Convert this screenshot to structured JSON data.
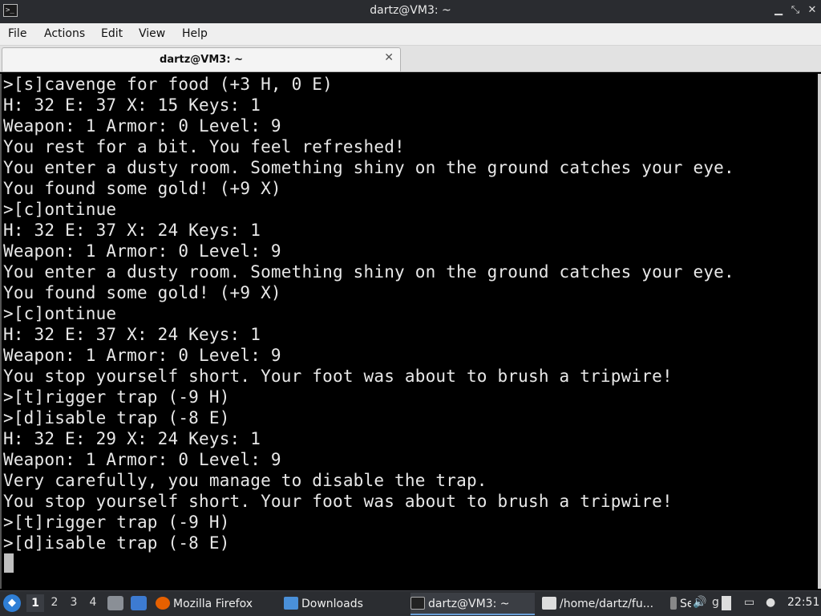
{
  "window": {
    "title": "dartz@VM3: ~",
    "controls": {
      "minimize": "▁",
      "maximize": "⤡",
      "close": "✕"
    }
  },
  "menubar": {
    "items": [
      "File",
      "Actions",
      "Edit",
      "View",
      "Help"
    ]
  },
  "tabs": [
    {
      "label": "dartz@VM3: ~",
      "close": "✕"
    }
  ],
  "terminal": {
    "lines": [
      ">[s]cavenge for food (+3 H, 0 E)",
      "H: 32 E: 37 X: 15 Keys: 1",
      "Weapon: 1 Armor: 0 Level: 9",
      "You rest for a bit. You feel refreshed!",
      "You enter a dusty room. Something shiny on the ground catches your eye.",
      "You found some gold! (+9 X)",
      ">[c]ontinue",
      "H: 32 E: 37 X: 24 Keys: 1",
      "Weapon: 1 Armor: 0 Level: 9",
      "You enter a dusty room. Something shiny on the ground catches your eye.",
      "You found some gold! (+9 X)",
      ">[c]ontinue",
      "H: 32 E: 37 X: 24 Keys: 1",
      "Weapon: 1 Armor: 0 Level: 9",
      "You stop yourself short. Your foot was about to brush a tripwire!",
      ">[t]rigger trap (-9 H)",
      ">[d]isable trap (-8 E)",
      "H: 32 E: 29 X: 24 Keys: 1",
      "Weapon: 1 Armor: 0 Level: 9",
      "Very carefully, you manage to disable the trap.",
      "You stop yourself short. Your foot was about to brush a tripwire!",
      ">[t]rigger trap (-9 H)",
      ">[d]isable trap (-8 E)"
    ]
  },
  "panel": {
    "workspaces": [
      "1",
      "2",
      "3",
      "4"
    ],
    "tasks": [
      {
        "label": "Mozilla Firefox",
        "icon": "firefox-icon",
        "color": "#e66000"
      },
      {
        "label": "Downloads",
        "icon": "folder-icon",
        "color": "#4a90d9"
      },
      {
        "label": "dartz@VM3: ~",
        "icon": "terminal-icon",
        "color": "#222222"
      },
      {
        "label": "/home/dartz/fu...",
        "icon": "text-editor-icon",
        "color": "#dddddd"
      },
      {
        "label": "Se",
        "icon": "settings-icon",
        "color": "#888888"
      }
    ],
    "tray_text": "g",
    "clock": "22:51"
  }
}
